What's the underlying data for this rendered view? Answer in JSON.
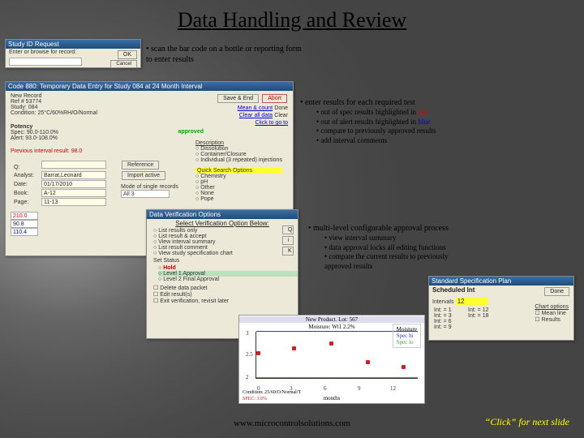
{
  "title": "Data Handling and Review",
  "caption1": {
    "line1": "• scan the bar code on a bottle or reporting form",
    "line2": "to enter results"
  },
  "caption2": {
    "line1": "• enter results for each required test",
    "s1a": "• out of spec results highlighted in ",
    "s1b": "red",
    "s2a": "• out of alert results highlighted in ",
    "s2b": "blue",
    "s3": "• compare to previously approved results",
    "s4": "• add interval comments"
  },
  "caption3": {
    "line1": "• multi-level configurable approval process",
    "s1": "• view interval summary",
    "s2": "• data approval locks all editing functions",
    "s3": "• compare the current results to previously",
    "s4": "approved results"
  },
  "dlg1": {
    "title": "Study ID Request",
    "prompt": "Enter or browse for record:",
    "ok": "OK",
    "cancel": "Cancel"
  },
  "dlg2": {
    "title": "Code 880: Temporary Data Entry for Study 084 at 24 Month Interval",
    "hdr1": "New Record",
    "ref": "Ref # 53774",
    "study": "Study: 084",
    "cond": "Condition:",
    "condv": "25°C/60%RH/O/Normal",
    "potency": "Potency",
    "spec": "Spec:  90.0-110.0%",
    "alert": "Alert:  93.0-108.0%",
    "msg": "Previous interval result: 98.0",
    "q_lbl": "Q:",
    "q_val": "",
    "analyst_lbl": "Analyst:",
    "analyst_val": "Barrat,Leonard",
    "date_lbl": "Date:",
    "date_val": "01/17/2010",
    "book_lbl": "Book:",
    "book_val": "A-12",
    "page_lbl": "Page:",
    "page_val": "11-13",
    "r1": "210.0",
    "r2": "90.8",
    "r3": "110.4",
    "save": "Save & End",
    "abort": "Abort",
    "link1": "Mean & count",
    "link1v": "Done",
    "link2": "Clear all data",
    "link2v": "Clear",
    "link3": "Click to go to",
    "ref_btn": "Reference",
    "imp_btn": "Import active",
    "mode_lbl": "Mode of single records",
    "mode_val": "All 3",
    "desc": "Description",
    "disso": "Dissolution",
    "cc": "Container/Closure",
    "ind": "Individual (3 repeated) injections",
    "quick": "Quick  Search Options",
    "o1": "Chemistry",
    "o2": "pH",
    "o3": "Other",
    "o4": "None",
    "o5": "Pope"
  },
  "dlg3": {
    "title": "Data Verification Options",
    "hdr": "Select Verification Option Below:",
    "o1": "List results only",
    "o2": "List result & accept",
    "o3": "View interval summary",
    "o4": "List result comment",
    "o5": "View study specification chart",
    "set": "Set Status",
    "st1": "Hold",
    "st2": "Level 1 Approval",
    "st3": "Level 2 Final Approval",
    "c1": "Delete data packet",
    "c2": "Edit result(s)",
    "c3": "Exit verification, revisit later",
    "ic1": "Q",
    "ic2": "i",
    "ic3": "K"
  },
  "dlg4": {
    "title": "Standard Specification Plan",
    "tab": "Scheduled Int",
    "btn": "Done",
    "col1": "Intervals",
    "col2": "12",
    "i1": "Int: = 1",
    "i2": "Int: = 3",
    "i3": "Int: = 6",
    "i4": "Int: = 9",
    "i5": "Int: = 12",
    "i6": "Int: = 18",
    "sec": "Chart options",
    "ck1": "Mean line",
    "ck2": "Results"
  },
  "chart_data": {
    "type": "line",
    "product": "New Product. Lot: 567",
    "subtitle": "Moisture: Wt1 2.2%",
    "x": [
      0,
      3,
      6,
      9,
      12
    ],
    "values": [
      2.5,
      2.6,
      2.7,
      2.3,
      2.2
    ],
    "xlabel": "months",
    "ylabel": "",
    "ylim": [
      2.0,
      3.0
    ],
    "yticks": [
      2.0,
      2.5,
      3.0
    ],
    "legend": [
      "Moisture",
      "Spec hi",
      "Spec lo"
    ],
    "footer1": "SPEC: 3.0%",
    "footer2": "Condition: 25/60/O/Normal/T"
  },
  "footer_url": "www.microcontrolsolutions.com",
  "footer_click": "“Click” for next slide"
}
